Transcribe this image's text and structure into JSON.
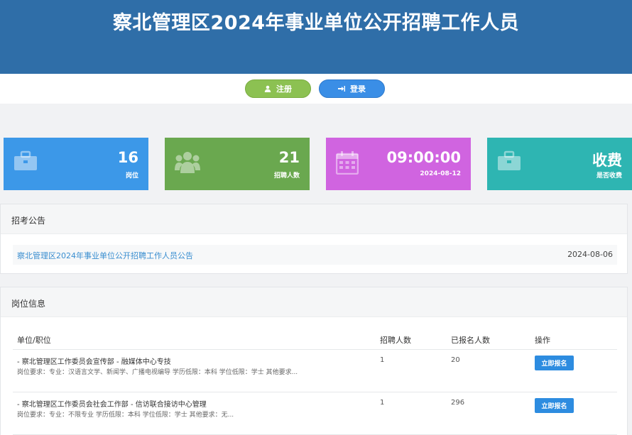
{
  "header": {
    "title": "察北管理区2024年事业单位公开招聘工作人员"
  },
  "auth": {
    "register_label": "注册",
    "login_label": "登录"
  },
  "stats": [
    {
      "value": "16",
      "label": "岗位",
      "icon": "briefcase-icon",
      "color": "#3c98e8"
    },
    {
      "value": "21",
      "label": "招聘人数",
      "icon": "users-icon",
      "color": "#6aa84f"
    },
    {
      "value": "09:00:00",
      "label": "2024-08-12",
      "icon": "calendar-icon",
      "color": "#d064e0"
    },
    {
      "value": "收费",
      "label": "是否收费",
      "icon": "briefcase-icon",
      "color": "#2eb5b2"
    }
  ],
  "notice": {
    "heading": "招考公告",
    "items": [
      {
        "title": "察北管理区2024年事业单位公开招聘工作人员公告",
        "date": "2024-08-06"
      }
    ]
  },
  "jobs": {
    "heading": "岗位信息",
    "columns": [
      "单位/职位",
      "招聘人数",
      "已报名人数",
      "操作"
    ],
    "rows": [
      {
        "title": "- 察北管理区工作委员会宣传部 - 融媒体中心专技",
        "req": "岗位要求：专业：汉语言文学、新闻学、广播电视编导 学历低限：本科 学位低限：学士 其他要求...",
        "count": "1",
        "applied": "20",
        "action": "立即报名"
      },
      {
        "title": "- 察北管理区工作委员会社会工作部 - 信访联合接访中心管理",
        "req": "岗位要求：专业：不限专业 学历低限：本科 学位低限：学士 其他要求：无...",
        "count": "1",
        "applied": "296",
        "action": "立即报名"
      }
    ]
  }
}
